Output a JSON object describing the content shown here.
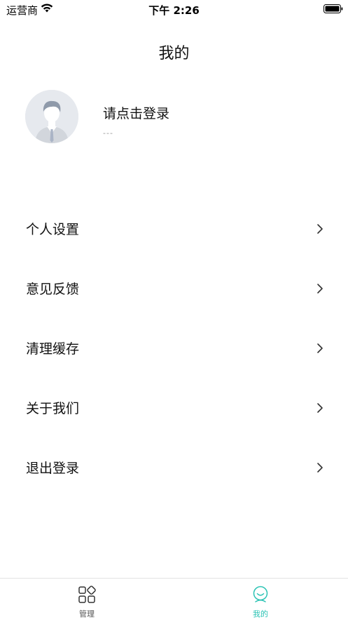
{
  "status_bar": {
    "carrier": "运营商",
    "time": "下午 2:26"
  },
  "nav": {
    "title": "我的"
  },
  "profile": {
    "login_prompt": "请点击登录",
    "subtitle": "---"
  },
  "menu": {
    "items": [
      {
        "label": "个人设置",
        "icon": "chevron-right-icon"
      },
      {
        "label": "意见反馈",
        "icon": "chevron-right-icon"
      },
      {
        "label": "清理缓存",
        "icon": "chevron-right-icon"
      },
      {
        "label": "关于我们",
        "icon": "chevron-right-icon"
      },
      {
        "label": "退出登录",
        "icon": "chevron-right-icon"
      }
    ]
  },
  "tab_bar": {
    "tabs": [
      {
        "label": "管理",
        "icon": "grid-icon",
        "active": false
      },
      {
        "label": "我的",
        "icon": "smiley-person-icon",
        "active": true
      }
    ],
    "active_color": "#2bc3b4"
  }
}
